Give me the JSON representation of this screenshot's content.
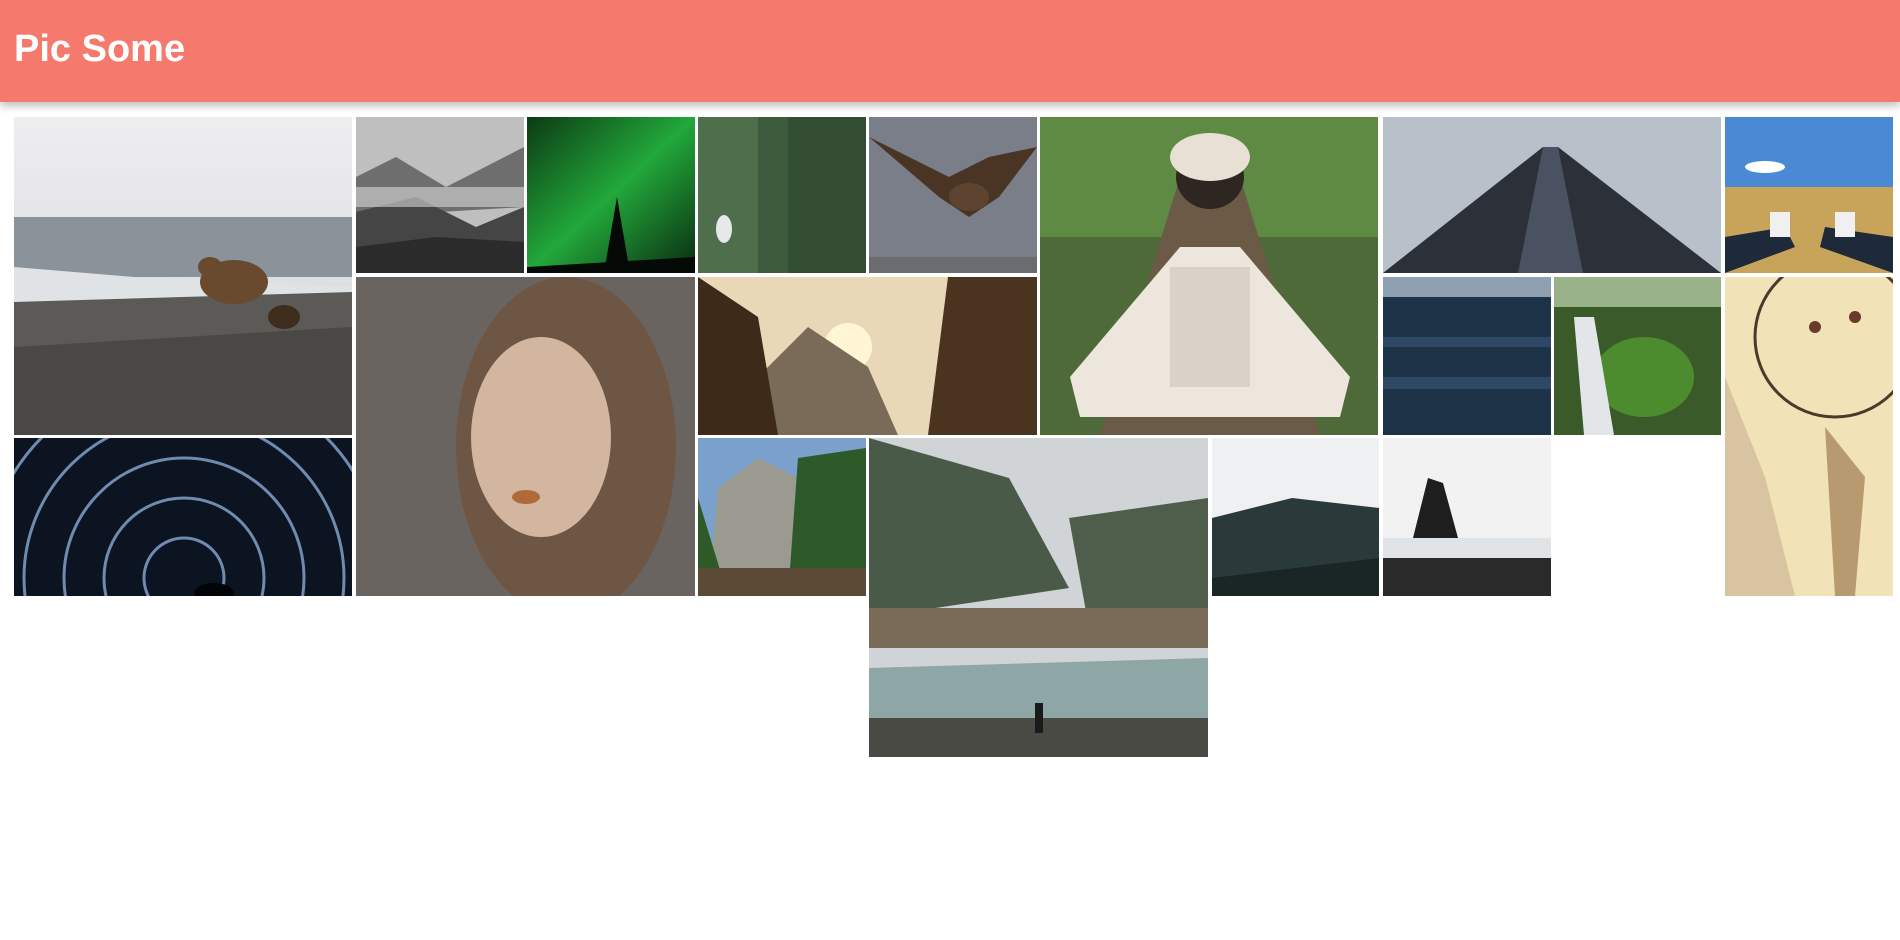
{
  "header": {
    "title": "Pic Some"
  },
  "colors": {
    "header_bg": "#f5796d",
    "header_text": "#ffffff",
    "page_bg": "#ffffff"
  },
  "photos": [
    {
      "subject": "bear-with-cubs-on-rocky-snowy-hillside"
    },
    {
      "subject": "misty-forested-hills-black-and-white"
    },
    {
      "subject": "green-aurora-over-tree-silhouette"
    },
    {
      "subject": "dense-evergreen-forest-with-bird"
    },
    {
      "subject": "eagle-spreading-wings-in-flight"
    },
    {
      "subject": "pug-wrapped-in-plaid-blanket-on-forest-path"
    },
    {
      "subject": "skyscraper-looking-up-at-sky"
    },
    {
      "subject": "feet-in-sneakers-over-golden-field"
    },
    {
      "subject": "star-trails-night-sky-swirl"
    },
    {
      "subject": "portrait-woman-with-curly-hair"
    },
    {
      "subject": "sunset-over-mountain-valley-with-pines"
    },
    {
      "subject": "dark-blue-ocean-waves"
    },
    {
      "subject": "waterfall-over-mossy-green-cliff"
    },
    {
      "subject": "dreamcatcher-with-feathers"
    },
    {
      "subject": "granite-cliffs-and-pine-trees-by-river"
    },
    {
      "subject": "hiker-standing-by-misty-forest-river"
    },
    {
      "subject": "fog-over-mountain-ridge"
    },
    {
      "subject": "sea-stack-rock-on-black-sand-beach"
    }
  ]
}
